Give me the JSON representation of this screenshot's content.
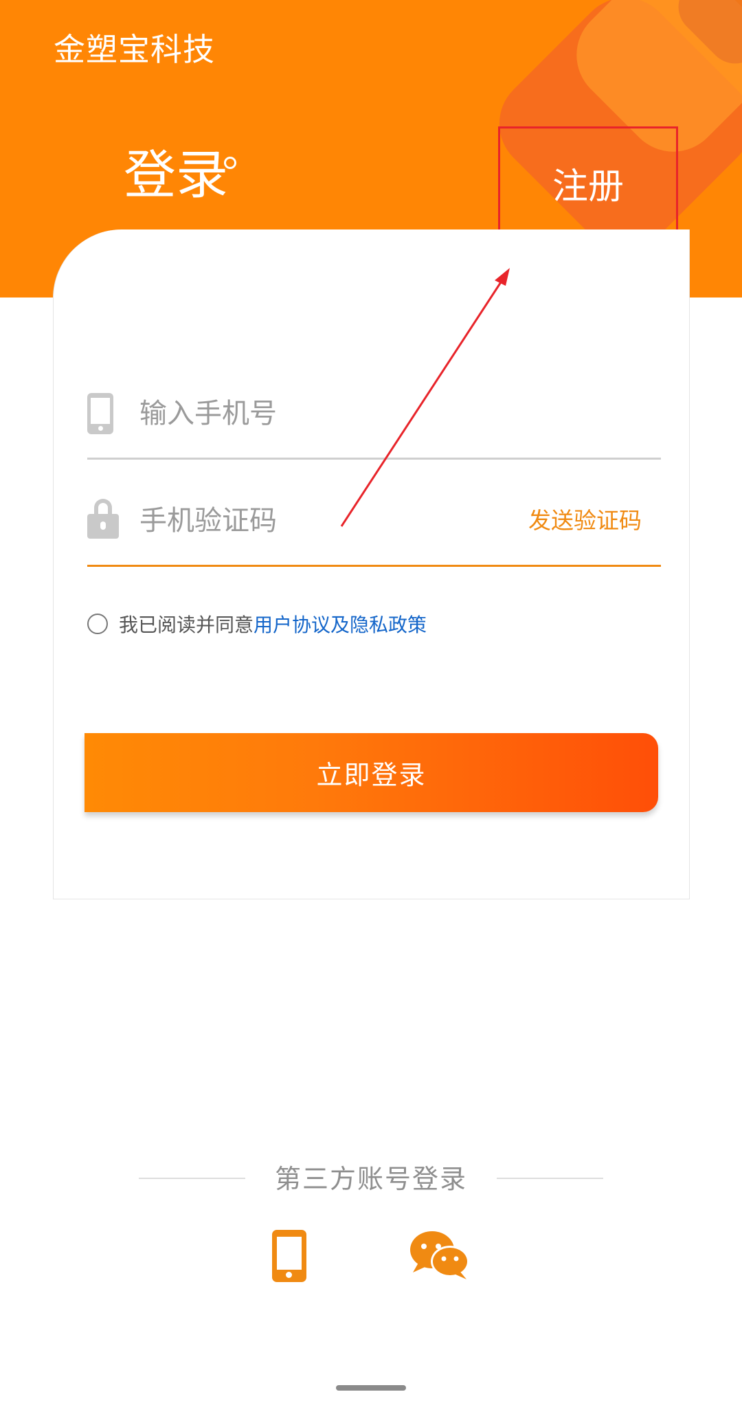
{
  "app": {
    "title": "金塑宝科技"
  },
  "tabs": {
    "login": "登录",
    "register": "注册"
  },
  "form": {
    "phone_placeholder": "输入手机号",
    "code_placeholder": "手机验证码",
    "send_code": "发送验证码",
    "agree_prefix": "我已阅读并同意",
    "agree_link": "用户协议及隐私政策",
    "login_button": "立即登录"
  },
  "third_party": {
    "label": "第三方账号登录",
    "options": [
      {
        "icon": "mobile-phone-icon"
      },
      {
        "icon": "wechat-icon"
      }
    ]
  },
  "colors": {
    "brand": "#FF8605",
    "accent": "#F08A12",
    "link": "#1365C9",
    "annotation": "#E8242A"
  }
}
